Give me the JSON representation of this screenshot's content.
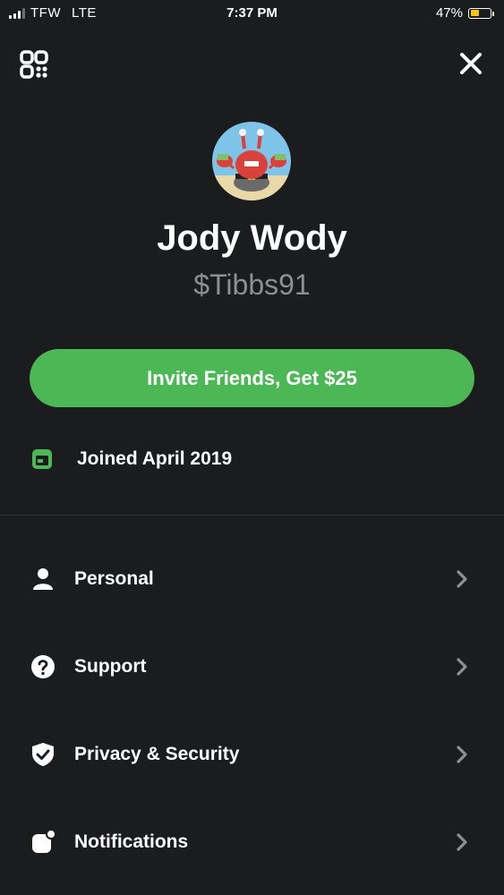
{
  "status_bar": {
    "carrier": "TFW",
    "network": "LTE",
    "time": "7:37 PM",
    "battery_percent": "47%",
    "battery_level": 0.47,
    "battery_color": "#f5c518"
  },
  "header": {
    "qr_icon": "qr-code-icon",
    "close_icon": "close-icon"
  },
  "profile": {
    "avatar_icon": "profile-avatar",
    "name": "Jody Wody",
    "cashtag": "$Tibbs91"
  },
  "invite": {
    "label": "Invite Friends, Get $25",
    "color": "#4cb755"
  },
  "joined": {
    "icon": "calendar-icon",
    "label": "Joined April 2019"
  },
  "menu": {
    "items": [
      {
        "label": "Personal",
        "icon": "person-icon"
      },
      {
        "label": "Support",
        "icon": "help-icon"
      },
      {
        "label": "Privacy & Security",
        "icon": "shield-check-icon"
      },
      {
        "label": "Notifications",
        "icon": "notification-icon"
      }
    ]
  },
  "colors": {
    "background": "#1b1c1e",
    "accent": "#4cb755",
    "secondary_text": "#8e8e93"
  }
}
